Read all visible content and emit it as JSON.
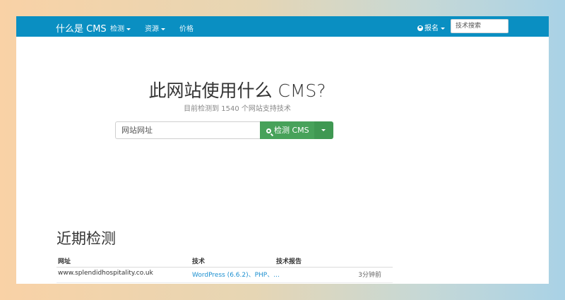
{
  "navbar": {
    "brand": "什么是 CMS",
    "items": [
      {
        "label": "检测",
        "has_caret": true
      },
      {
        "label": "资源",
        "has_caret": true
      },
      {
        "label": "价格",
        "has_caret": false
      }
    ],
    "user_menu": "报名",
    "user_icon": "user-circle-icon",
    "search_placeholder": "技术搜索"
  },
  "hero": {
    "title": "此网站使用什么 CMS?",
    "subtitle": "目前检测到 1540 个网站支持技术",
    "input_placeholder": "网站网址",
    "detect_button": "检测 CMS",
    "button_color": "#47a25a"
  },
  "recent": {
    "title": "近期检测",
    "headers": [
      "网址",
      "技术",
      "技术报告"
    ],
    "rows": [
      {
        "url": "www.splendidhospitality.co.uk",
        "tech": "WordPress (6.6.2)、PHP、...",
        "time": "3分钟前"
      }
    ]
  },
  "colors": {
    "navbar": "#0a8fc2",
    "link": "#1b8fd0"
  }
}
